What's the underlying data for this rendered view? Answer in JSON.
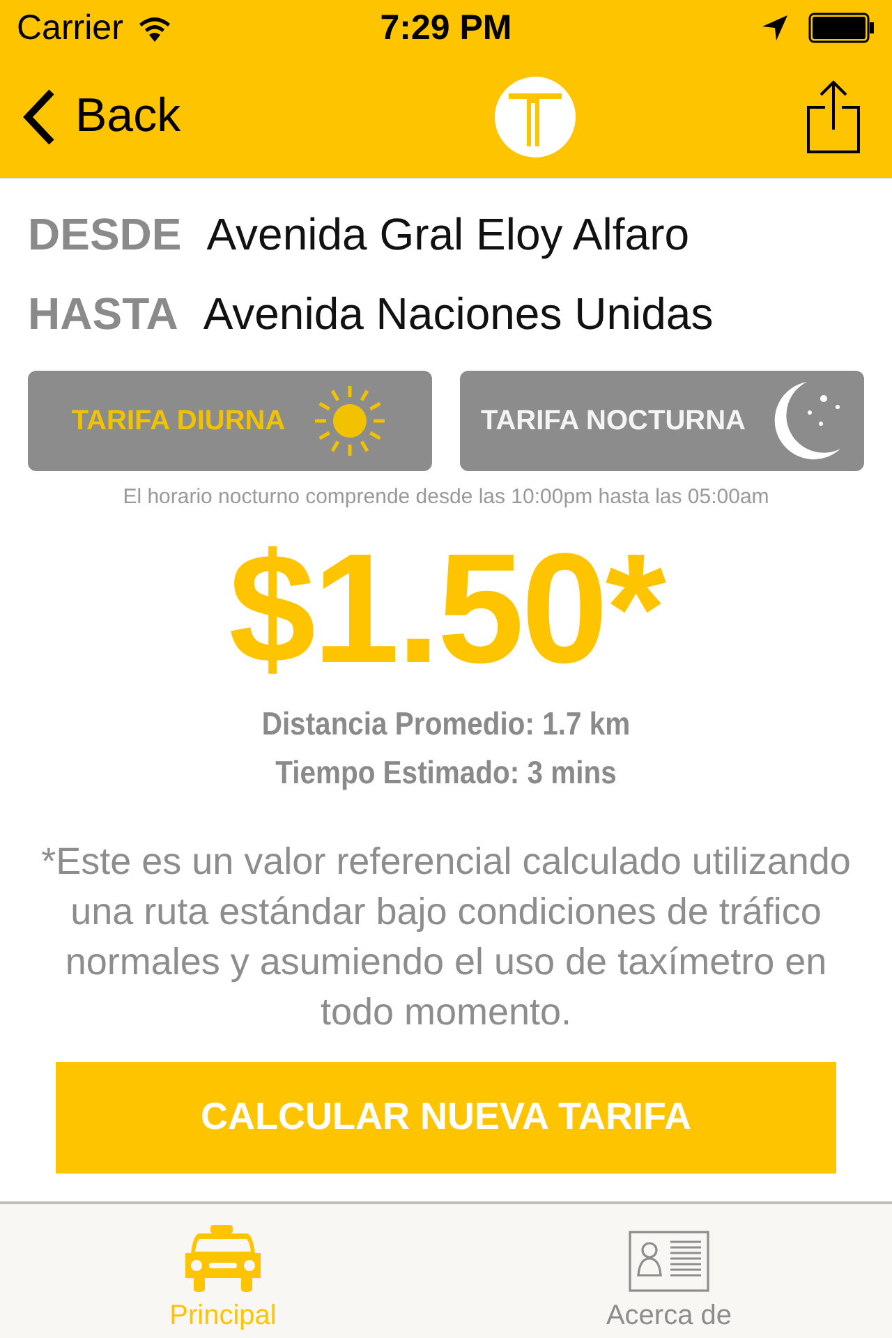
{
  "status_bar": {
    "carrier": "Carrier",
    "time": "7:29 PM"
  },
  "nav": {
    "back": "Back"
  },
  "route": [
    {
      "label": "DESDE",
      "value": "Avenida Gral Eloy Alfaro"
    },
    {
      "label": "HASTA",
      "value": "Avenida Naciones Unidas"
    }
  ],
  "tariffs": [
    {
      "kind": "day",
      "label": "TARIFA DIURNA",
      "selected": true
    },
    {
      "kind": "night",
      "label": "TARIFA NOCTURNA",
      "selected": false
    }
  ],
  "night_note": "El horario nocturno comprende desde las 10:00pm hasta las 05:00am",
  "price": "$1.50*",
  "distance": "Distancia Promedio: 1.7 km",
  "time_estimate": "Tiempo Estimado: 3 mins",
  "disclaimer": "*Este es un valor referencial calculado utilizando una ruta estándar bajo condiciones de tráfico normales y asumiendo el uso de taxímetro en todo momento.",
  "action_button": "CALCULAR NUEVA TARIFA",
  "tab_bar": [
    {
      "kind": "taxi",
      "label": "Principal",
      "selected": true
    },
    {
      "kind": "about",
      "label": "Acerca de",
      "selected": false
    }
  ]
}
